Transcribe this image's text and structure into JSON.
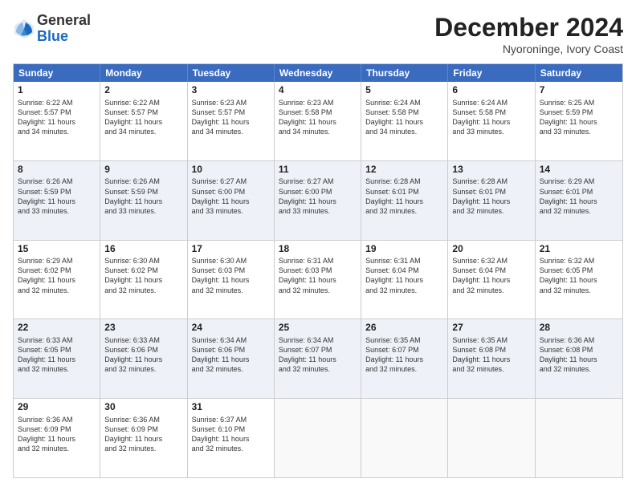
{
  "header": {
    "logo_line1": "General",
    "logo_line2": "Blue",
    "month": "December 2024",
    "location": "Nyoroninge, Ivory Coast"
  },
  "weekdays": [
    "Sunday",
    "Monday",
    "Tuesday",
    "Wednesday",
    "Thursday",
    "Friday",
    "Saturday"
  ],
  "rows": [
    [
      {
        "day": "1",
        "lines": [
          "Sunrise: 6:22 AM",
          "Sunset: 5:57 PM",
          "Daylight: 11 hours",
          "and 34 minutes."
        ]
      },
      {
        "day": "2",
        "lines": [
          "Sunrise: 6:22 AM",
          "Sunset: 5:57 PM",
          "Daylight: 11 hours",
          "and 34 minutes."
        ]
      },
      {
        "day": "3",
        "lines": [
          "Sunrise: 6:23 AM",
          "Sunset: 5:57 PM",
          "Daylight: 11 hours",
          "and 34 minutes."
        ]
      },
      {
        "day": "4",
        "lines": [
          "Sunrise: 6:23 AM",
          "Sunset: 5:58 PM",
          "Daylight: 11 hours",
          "and 34 minutes."
        ]
      },
      {
        "day": "5",
        "lines": [
          "Sunrise: 6:24 AM",
          "Sunset: 5:58 PM",
          "Daylight: 11 hours",
          "and 34 minutes."
        ]
      },
      {
        "day": "6",
        "lines": [
          "Sunrise: 6:24 AM",
          "Sunset: 5:58 PM",
          "Daylight: 11 hours",
          "and 33 minutes."
        ]
      },
      {
        "day": "7",
        "lines": [
          "Sunrise: 6:25 AM",
          "Sunset: 5:59 PM",
          "Daylight: 11 hours",
          "and 33 minutes."
        ]
      }
    ],
    [
      {
        "day": "8",
        "lines": [
          "Sunrise: 6:26 AM",
          "Sunset: 5:59 PM",
          "Daylight: 11 hours",
          "and 33 minutes."
        ]
      },
      {
        "day": "9",
        "lines": [
          "Sunrise: 6:26 AM",
          "Sunset: 5:59 PM",
          "Daylight: 11 hours",
          "and 33 minutes."
        ]
      },
      {
        "day": "10",
        "lines": [
          "Sunrise: 6:27 AM",
          "Sunset: 6:00 PM",
          "Daylight: 11 hours",
          "and 33 minutes."
        ]
      },
      {
        "day": "11",
        "lines": [
          "Sunrise: 6:27 AM",
          "Sunset: 6:00 PM",
          "Daylight: 11 hours",
          "and 33 minutes."
        ]
      },
      {
        "day": "12",
        "lines": [
          "Sunrise: 6:28 AM",
          "Sunset: 6:01 PM",
          "Daylight: 11 hours",
          "and 32 minutes."
        ]
      },
      {
        "day": "13",
        "lines": [
          "Sunrise: 6:28 AM",
          "Sunset: 6:01 PM",
          "Daylight: 11 hours",
          "and 32 minutes."
        ]
      },
      {
        "day": "14",
        "lines": [
          "Sunrise: 6:29 AM",
          "Sunset: 6:01 PM",
          "Daylight: 11 hours",
          "and 32 minutes."
        ]
      }
    ],
    [
      {
        "day": "15",
        "lines": [
          "Sunrise: 6:29 AM",
          "Sunset: 6:02 PM",
          "Daylight: 11 hours",
          "and 32 minutes."
        ]
      },
      {
        "day": "16",
        "lines": [
          "Sunrise: 6:30 AM",
          "Sunset: 6:02 PM",
          "Daylight: 11 hours",
          "and 32 minutes."
        ]
      },
      {
        "day": "17",
        "lines": [
          "Sunrise: 6:30 AM",
          "Sunset: 6:03 PM",
          "Daylight: 11 hours",
          "and 32 minutes."
        ]
      },
      {
        "day": "18",
        "lines": [
          "Sunrise: 6:31 AM",
          "Sunset: 6:03 PM",
          "Daylight: 11 hours",
          "and 32 minutes."
        ]
      },
      {
        "day": "19",
        "lines": [
          "Sunrise: 6:31 AM",
          "Sunset: 6:04 PM",
          "Daylight: 11 hours",
          "and 32 minutes."
        ]
      },
      {
        "day": "20",
        "lines": [
          "Sunrise: 6:32 AM",
          "Sunset: 6:04 PM",
          "Daylight: 11 hours",
          "and 32 minutes."
        ]
      },
      {
        "day": "21",
        "lines": [
          "Sunrise: 6:32 AM",
          "Sunset: 6:05 PM",
          "Daylight: 11 hours",
          "and 32 minutes."
        ]
      }
    ],
    [
      {
        "day": "22",
        "lines": [
          "Sunrise: 6:33 AM",
          "Sunset: 6:05 PM",
          "Daylight: 11 hours",
          "and 32 minutes."
        ]
      },
      {
        "day": "23",
        "lines": [
          "Sunrise: 6:33 AM",
          "Sunset: 6:06 PM",
          "Daylight: 11 hours",
          "and 32 minutes."
        ]
      },
      {
        "day": "24",
        "lines": [
          "Sunrise: 6:34 AM",
          "Sunset: 6:06 PM",
          "Daylight: 11 hours",
          "and 32 minutes."
        ]
      },
      {
        "day": "25",
        "lines": [
          "Sunrise: 6:34 AM",
          "Sunset: 6:07 PM",
          "Daylight: 11 hours",
          "and 32 minutes."
        ]
      },
      {
        "day": "26",
        "lines": [
          "Sunrise: 6:35 AM",
          "Sunset: 6:07 PM",
          "Daylight: 11 hours",
          "and 32 minutes."
        ]
      },
      {
        "day": "27",
        "lines": [
          "Sunrise: 6:35 AM",
          "Sunset: 6:08 PM",
          "Daylight: 11 hours",
          "and 32 minutes."
        ]
      },
      {
        "day": "28",
        "lines": [
          "Sunrise: 6:36 AM",
          "Sunset: 6:08 PM",
          "Daylight: 11 hours",
          "and 32 minutes."
        ]
      }
    ],
    [
      {
        "day": "29",
        "lines": [
          "Sunrise: 6:36 AM",
          "Sunset: 6:09 PM",
          "Daylight: 11 hours",
          "and 32 minutes."
        ]
      },
      {
        "day": "30",
        "lines": [
          "Sunrise: 6:36 AM",
          "Sunset: 6:09 PM",
          "Daylight: 11 hours",
          "and 32 minutes."
        ]
      },
      {
        "day": "31",
        "lines": [
          "Sunrise: 6:37 AM",
          "Sunset: 6:10 PM",
          "Daylight: 11 hours",
          "and 32 minutes."
        ]
      },
      {
        "day": "",
        "lines": []
      },
      {
        "day": "",
        "lines": []
      },
      {
        "day": "",
        "lines": []
      },
      {
        "day": "",
        "lines": []
      }
    ]
  ]
}
